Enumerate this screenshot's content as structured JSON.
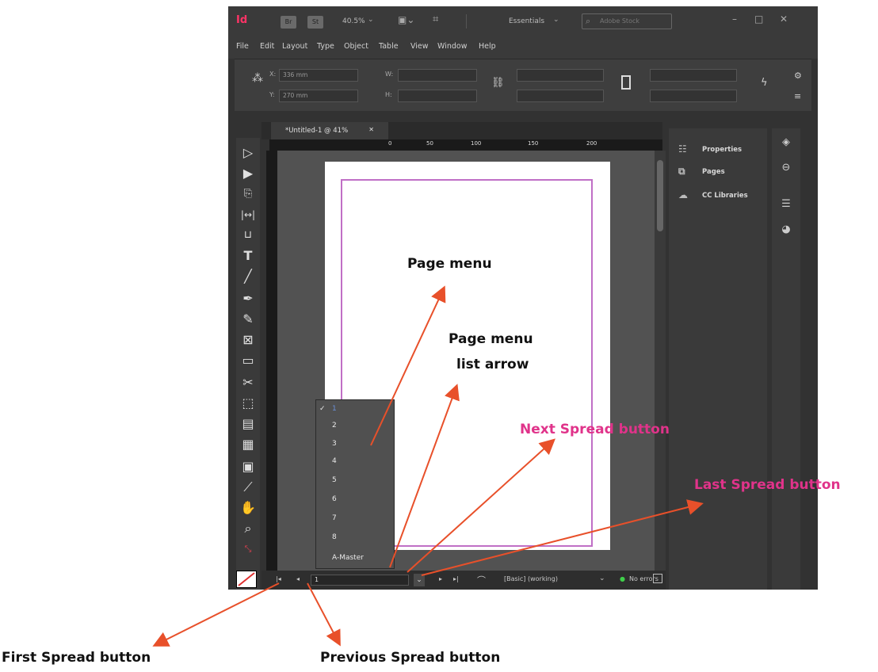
{
  "titlebar": {
    "app_logo": "Id",
    "br_label": "Br",
    "st_label": "St",
    "zoom": "40.5%",
    "workspace": "Essentials",
    "stock_placeholder": "Adobe Stock"
  },
  "menubar": [
    "File",
    "Edit",
    "Layout",
    "Type",
    "Object",
    "Table",
    "View",
    "Window",
    "Help"
  ],
  "control": {
    "x_label": "X:",
    "x_value": "336 mm",
    "y_label": "Y:",
    "y_value": "270 mm",
    "w_label": "W:",
    "h_label": "H:"
  },
  "document_tab": "*Untitled-1 @ 41%",
  "ruler_marks": [
    "0",
    "50",
    "100",
    "150",
    "200"
  ],
  "panels": [
    {
      "icon": "properties-icon",
      "label": "Properties"
    },
    {
      "icon": "pages-icon",
      "label": "Pages"
    },
    {
      "icon": "cc-libraries-icon",
      "label": "CC Libraries"
    }
  ],
  "page_menu": {
    "items": [
      "1",
      "2",
      "3",
      "4",
      "5",
      "6",
      "7",
      "8",
      "A-Master"
    ],
    "selected": "1"
  },
  "statusbar": {
    "page_value": "1",
    "profile": "[Basic] (working)",
    "errors": "No errors"
  },
  "annotations": {
    "page_menu": "Page menu",
    "page_menu_list_arrow_line1": "Page menu",
    "page_menu_list_arrow_line2": "list arrow",
    "next_spread": "Next Spread button",
    "last_spread": "Last Spread button",
    "first_spread": "First Spread button",
    "previous_spread": "Previous Spread button"
  },
  "colors": {
    "annotation_pink": "#e0338a",
    "arrow": "#e8502a",
    "margin_guide": "#c06fc6",
    "app_bg": "#323232"
  }
}
